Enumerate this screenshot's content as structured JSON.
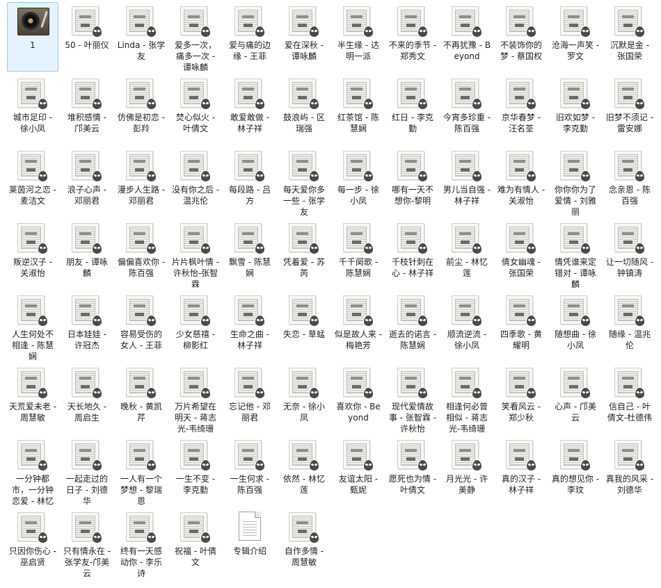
{
  "files": [
    {
      "name": "1",
      "icon": "turntable-icon",
      "selected": true
    },
    {
      "name": "50 - 叶丽仪",
      "icon": "cd-cover-icon"
    },
    {
      "name": "Linda - 张学友",
      "icon": "cd-cover-icon"
    },
    {
      "name": "爱多一次，痛多一次 - 谭咏麟",
      "icon": "cd-cover-icon"
    },
    {
      "name": "爱与痛的边缘 - 王菲",
      "icon": "cd-cover-icon"
    },
    {
      "name": "爱在深秋 - 谭咏麟",
      "icon": "cd-cover-icon"
    },
    {
      "name": "半生缘 - 达明一派",
      "icon": "cd-cover-icon"
    },
    {
      "name": "不来的季节 - 郑秀文",
      "icon": "cd-cover-icon"
    },
    {
      "name": "不再犹豫 - Beyond",
      "icon": "cd-cover-icon"
    },
    {
      "name": "不装饰你的梦 - 蔡国权",
      "icon": "cd-cover-icon"
    },
    {
      "name": "沧海一声笑 - 罗文",
      "icon": "cd-cover-icon"
    },
    {
      "name": "沉默是金 - 张国荣",
      "icon": "cd-cover-icon"
    },
    {
      "name": "城市足印 - 徐小凤",
      "icon": "cd-cover-icon"
    },
    {
      "name": "堆积感情 - 邝美云",
      "icon": "cd-cover-icon"
    },
    {
      "name": "仿佛是初恋 - 彭羚",
      "icon": "cd-cover-icon"
    },
    {
      "name": "焚心似火 - 叶倩文",
      "icon": "cd-cover-icon"
    },
    {
      "name": "敢爱敢做 - 林子祥",
      "icon": "cd-cover-icon"
    },
    {
      "name": "鼓浪屿 - 区瑞强",
      "icon": "cd-cover-icon"
    },
    {
      "name": "红茶馆 - 陈慧娴",
      "icon": "cd-cover-icon"
    },
    {
      "name": "红日 - 李克勤",
      "icon": "cd-cover-icon"
    },
    {
      "name": "今宵多珍重 - 陈百强",
      "icon": "cd-cover-icon"
    },
    {
      "name": "京华春梦 - 汪名荃",
      "icon": "cd-cover-icon"
    },
    {
      "name": "旧欢如梦 - 李克勤",
      "icon": "cd-cover-icon"
    },
    {
      "name": "旧梦不须记 - 雷安娜",
      "icon": "cd-cover-icon"
    },
    {
      "name": "莱茵河之恋 - 麦洁文",
      "icon": "cd-cover-icon"
    },
    {
      "name": "浪子心声 - 邓丽君",
      "icon": "cd-cover-icon"
    },
    {
      "name": "漫步人生路 -邓丽君",
      "icon": "cd-cover-icon"
    },
    {
      "name": "没有你之后 - 温兆伦",
      "icon": "cd-cover-icon"
    },
    {
      "name": "每段路 - 吕方",
      "icon": "cd-cover-icon"
    },
    {
      "name": "每天爱你多一些 - 张学友",
      "icon": "cd-cover-icon"
    },
    {
      "name": "每一步 - 徐小凤",
      "icon": "cd-cover-icon"
    },
    {
      "name": "哪有一天不想你-黎明",
      "icon": "cd-cover-icon"
    },
    {
      "name": "男儿当自强 - 林子祥",
      "icon": "cd-cover-icon"
    },
    {
      "name": "难为有情人 - 关淑怡",
      "icon": "cd-cover-icon"
    },
    {
      "name": "你你你为了爱情 - 刘雅丽",
      "icon": "cd-cover-icon"
    },
    {
      "name": "念亲恩 - 陈百强",
      "icon": "cd-cover-icon"
    },
    {
      "name": "叛逆汉子 - 关淑怡",
      "icon": "cd-cover-icon"
    },
    {
      "name": "朋友 - 谭咏麟",
      "icon": "cd-cover-icon"
    },
    {
      "name": "偏偏喜欢你 - 陈百强",
      "icon": "cd-cover-icon"
    },
    {
      "name": "片片枫叶情 - 许秋怡-张智霖",
      "icon": "cd-cover-icon"
    },
    {
      "name": "飘雪 - 陈慧娴",
      "icon": "cd-cover-icon"
    },
    {
      "name": "凭着爱 - 苏芮",
      "icon": "cd-cover-icon"
    },
    {
      "name": "千千阕歌 - 陈慧娴",
      "icon": "cd-cover-icon"
    },
    {
      "name": "千枝针刺在心 - 林子祥",
      "icon": "cd-cover-icon"
    },
    {
      "name": "前尘 - 林忆莲",
      "icon": "cd-cover-icon"
    },
    {
      "name": "倩女幽魂 - 张国荣",
      "icon": "cd-cover-icon"
    },
    {
      "name": "情凭谁来定错对 - 谭咏麟",
      "icon": "cd-cover-icon"
    },
    {
      "name": "让一切随风 - 钟镇涛",
      "icon": "cd-cover-icon"
    },
    {
      "name": "人生何处不相逢 - 陈慧娴",
      "icon": "cd-cover-icon"
    },
    {
      "name": "日本娃娃 - 许冠杰",
      "icon": "cd-cover-icon"
    },
    {
      "name": "容易受伤的女人 - 王菲",
      "icon": "cd-cover-icon"
    },
    {
      "name": "少女慈禧 - 柳影红",
      "icon": "cd-cover-icon"
    },
    {
      "name": "生命之曲 - 林子祥",
      "icon": "cd-cover-icon"
    },
    {
      "name": "失恋 - 草蜢",
      "icon": "cd-cover-icon"
    },
    {
      "name": "似是故人来 - 梅艳芳",
      "icon": "cd-cover-icon"
    },
    {
      "name": "逝去的诺言 - 陈慧娴",
      "icon": "cd-cover-icon"
    },
    {
      "name": "顺流逆流 - 徐小凤",
      "icon": "cd-cover-icon"
    },
    {
      "name": "四季歌 - 黄耀明",
      "icon": "cd-cover-icon"
    },
    {
      "name": "随想曲 - 徐小凤",
      "icon": "cd-cover-icon"
    },
    {
      "name": "随缘 - 温兆伦",
      "icon": "cd-cover-icon"
    },
    {
      "name": "天荒爱未老 - 周慧敏",
      "icon": "cd-cover-icon"
    },
    {
      "name": "天长地久 - 周启生",
      "icon": "cd-cover-icon"
    },
    {
      "name": "晚秋 - 黄凯芹",
      "icon": "cd-cover-icon"
    },
    {
      "name": "万片希望在明天 - 蒋志光-韦绮珊",
      "icon": "cd-cover-icon"
    },
    {
      "name": "忘记他 - 邓丽君",
      "icon": "cd-cover-icon"
    },
    {
      "name": "无奈 - 徐小凤",
      "icon": "cd-cover-icon"
    },
    {
      "name": "喜欢你 - Beyond",
      "icon": "cd-cover-icon"
    },
    {
      "name": "现代爱情故事 - 张智霖 -许秋怡",
      "icon": "cd-cover-icon"
    },
    {
      "name": "相逢何必曾相似 - 蒋志光-韦绮珊",
      "icon": "cd-cover-icon"
    },
    {
      "name": "笑看风云 - 郑少秋",
      "icon": "cd-cover-icon"
    },
    {
      "name": "心声 - 邝美云",
      "icon": "cd-cover-icon"
    },
    {
      "name": "信自己 - 叶倩文-杜德伟",
      "icon": "cd-cover-icon"
    },
    {
      "name": "一分钟都市，一分钟恋爱 - 林忆莲",
      "icon": "cd-cover-icon"
    },
    {
      "name": "一起走过的日子 - 刘德华",
      "icon": "cd-cover-icon"
    },
    {
      "name": "一人有一个梦想 - 黎瑞恩",
      "icon": "cd-cover-icon"
    },
    {
      "name": "一生不变 - 李克勤",
      "icon": "cd-cover-icon"
    },
    {
      "name": "一生何求 - 陈百强",
      "icon": "cd-cover-icon"
    },
    {
      "name": "依然 - 林忆莲",
      "icon": "cd-cover-icon"
    },
    {
      "name": "友谊太阳 - 甄妮",
      "icon": "cd-cover-icon"
    },
    {
      "name": "愿死也为情 - 叶倩文",
      "icon": "cd-cover-icon"
    },
    {
      "name": "月光光 - 许美静",
      "icon": "cd-cover-icon"
    },
    {
      "name": "真的汉子 - 林子祥",
      "icon": "cd-cover-icon"
    },
    {
      "name": "真的想见你 - 李玟",
      "icon": "cd-cover-icon"
    },
    {
      "name": "真我的风采 - 刘德华",
      "icon": "cd-cover-icon"
    },
    {
      "name": "只因你伤心 - 巫启贤",
      "icon": "cd-cover-icon"
    },
    {
      "name": "只有情永在 - 张学友-邝美云",
      "icon": "cd-cover-icon"
    },
    {
      "name": "终有一天感动你 - 李乐诗",
      "icon": "cd-cover-icon"
    },
    {
      "name": "祝福 - 叶倩文",
      "icon": "cd-cover-icon"
    },
    {
      "name": "专辑介绍",
      "icon": "text-document-icon"
    },
    {
      "name": "自作多情 - 周慧敏",
      "icon": "cd-cover-icon"
    }
  ]
}
